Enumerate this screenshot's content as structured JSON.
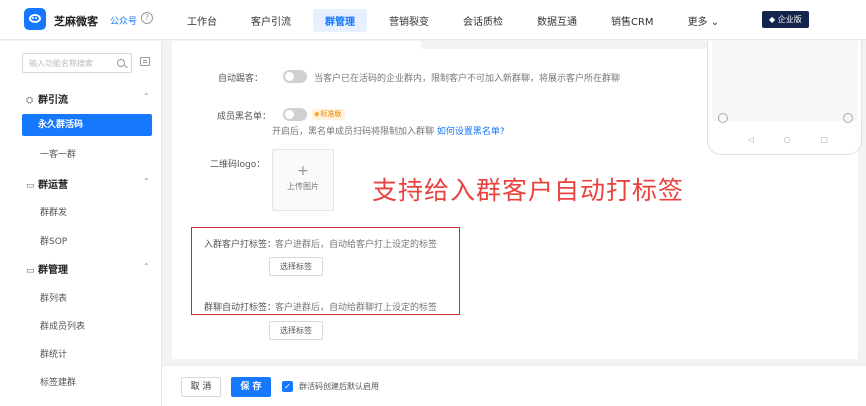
{
  "header": {
    "brand": "芝麻微客",
    "account_link": "公众号",
    "help_glyph": "?",
    "nav": [
      "工作台",
      "客户引流",
      "群管理",
      "营销裂变",
      "会话质检",
      "数据互通",
      "销售CRM"
    ],
    "more_label": "更多",
    "enterprise_badge": "企业版"
  },
  "sidebar": {
    "search_placeholder": "输入功能名称搜索",
    "groups": [
      {
        "title": "群引流",
        "icon": "group-icon",
        "items": [
          "永久群活码",
          "一客一群"
        ]
      },
      {
        "title": "群运营",
        "icon": "chat-icon",
        "items": [
          "群群发",
          "群SOP"
        ]
      },
      {
        "title": "群管理",
        "icon": "chat-icon",
        "items": [
          "群列表",
          "群成员列表",
          "群统计",
          "标签建群"
        ]
      }
    ],
    "active_item": "永久群活码"
  },
  "form": {
    "auto_kick_label": "自动踢客：",
    "auto_kick_desc": "当客户已在活码的企业群内，限制客户不可加入新群聊，将展示客户所在群聊",
    "blacklist_label": "成员黑名单：",
    "blacklist_badge": "标准版",
    "blacklist_desc": "开启后，黑名单成员扫码将限制加入群聊",
    "blacklist_link": "如何设置黑名单?",
    "qr_logo_label": "二维码logo：",
    "upload_label": "上传图片",
    "caption": "支持给入群客户自动打标签",
    "customer_tag_label": "入群客户打标签：",
    "customer_tag_desc": "客户进群后，自动给客户打上设定的标签",
    "select_tag_button": "选择标签",
    "group_tag_label": "群聊自动打标签：",
    "group_tag_desc": "客户进群后，自动给群聊打上设定的标签"
  },
  "footer": {
    "cancel": "取 消",
    "save": "保 存",
    "default_enable_label": "群活码创建后默认启用"
  },
  "colors": {
    "accent": "#1677ff",
    "caption": "#e8433f",
    "highlight_box": "#c9302c",
    "badge_bg": "#14244d"
  }
}
